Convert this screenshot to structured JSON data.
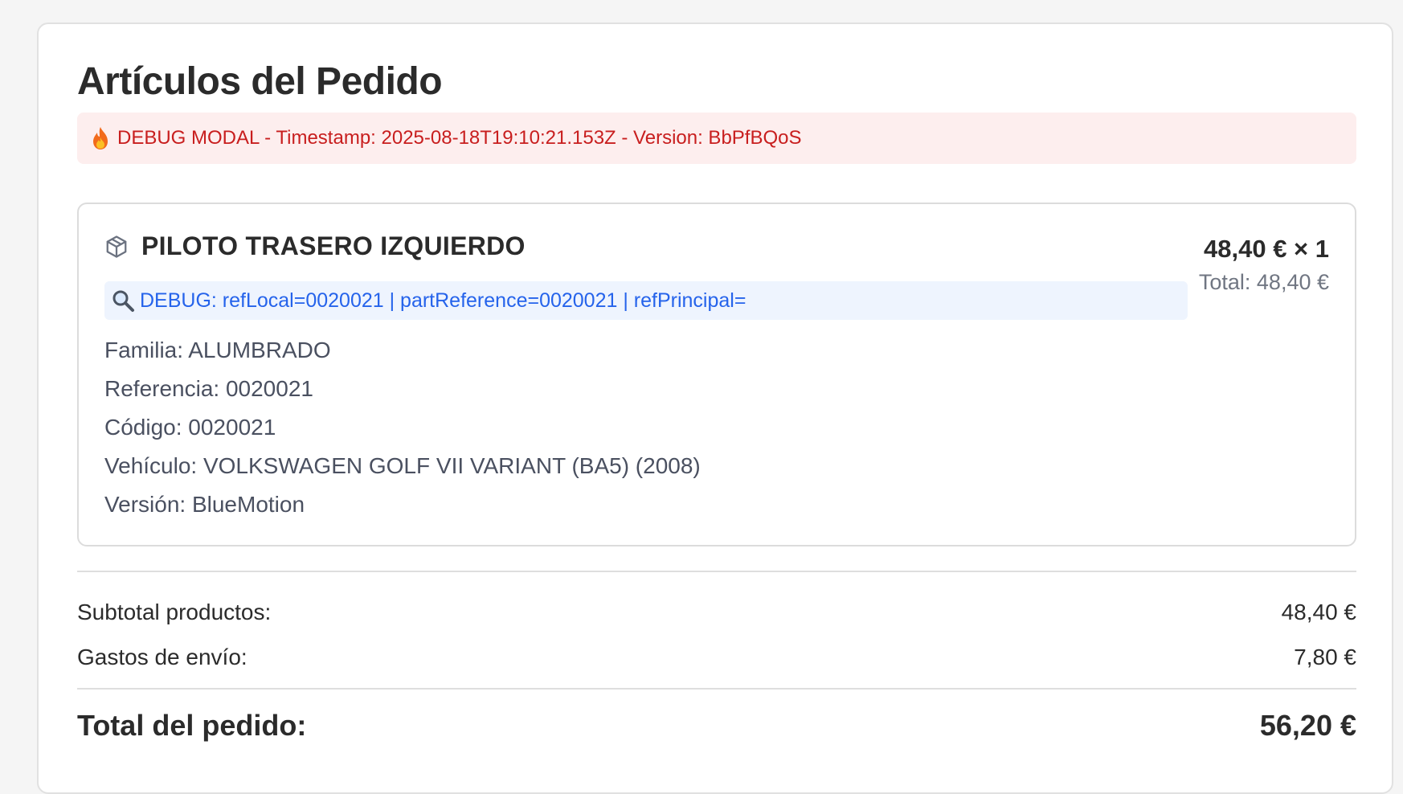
{
  "modal": {
    "title": "Artículos del Pedido",
    "debug_banner": "DEBUG MODAL - Timestamp: 2025-08-18T19:10:21.153Z - Version: BbPfBQoS"
  },
  "item": {
    "name": "PILOTO TRASERO IZQUIERDO",
    "unit_price_qty": "48,40 € × 1",
    "line_total": "Total: 48,40 €",
    "debug_refs": "DEBUG: refLocal=0020021 | partReference=0020021 | refPrincipal=",
    "details": {
      "familia": "Familia: ALUMBRADO",
      "referencia": "Referencia: 0020021",
      "codigo": "Código: 0020021",
      "vehiculo": "Vehículo: VOLKSWAGEN GOLF VII VARIANT (BA5) (2008)",
      "version": "Versión: BlueMotion"
    }
  },
  "summary": {
    "subtotal_label": "Subtotal productos:",
    "subtotal_value": "48,40 €",
    "shipping_label": "Gastos de envío:",
    "shipping_value": "7,80 €",
    "total_label": "Total del pedido:",
    "total_value": "56,20 €"
  },
  "colors": {
    "debug_red": "#c81e1e",
    "debug_red_bg": "#fdeeee",
    "debug_blue": "#2563eb",
    "debug_blue_bg": "#eef4fe"
  },
  "icons": {
    "banner": "fire-icon",
    "item": "box-icon",
    "debug": "magnifier-icon"
  }
}
